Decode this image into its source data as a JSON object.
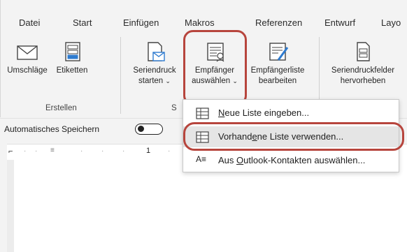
{
  "tabs": [
    "Datei",
    "Start",
    "Einfügen",
    "Makros",
    "Referenzen",
    "Entwurf",
    "Layo"
  ],
  "commands": {
    "envelopes": "Umschläge",
    "labels": "Etiketten",
    "mailmerge_line1": "Seriendruck",
    "mailmerge_line2": "starten",
    "recipients_line1": "Empfänger",
    "recipients_line2": "auswählen",
    "edit_list_line1": "Empfängerliste",
    "edit_list_line2": "bearbeiten",
    "fields_line1": "Seriendruckfelder",
    "fields_line2": "hervorheben"
  },
  "groups": {
    "create": "Erstellen",
    "start_initial": "S"
  },
  "autosave": {
    "label": "Automatisches Speichern"
  },
  "ruler": {
    "mark": "1"
  },
  "menu": {
    "item1_pre": "",
    "item1_u": "N",
    "item1_post": "eue Liste eingeben...",
    "item2_pre": "Vorhand",
    "item2_u": "e",
    "item2_post": "ne Liste verwenden...",
    "item3_pre": "Aus ",
    "item3_u": "O",
    "item3_post": "utlook-Kontakten auswählen...",
    "item3_icon_text": "A≡"
  },
  "colors": {
    "highlight": "#b7453d",
    "ribbon_bg": "#f3f3f3"
  }
}
